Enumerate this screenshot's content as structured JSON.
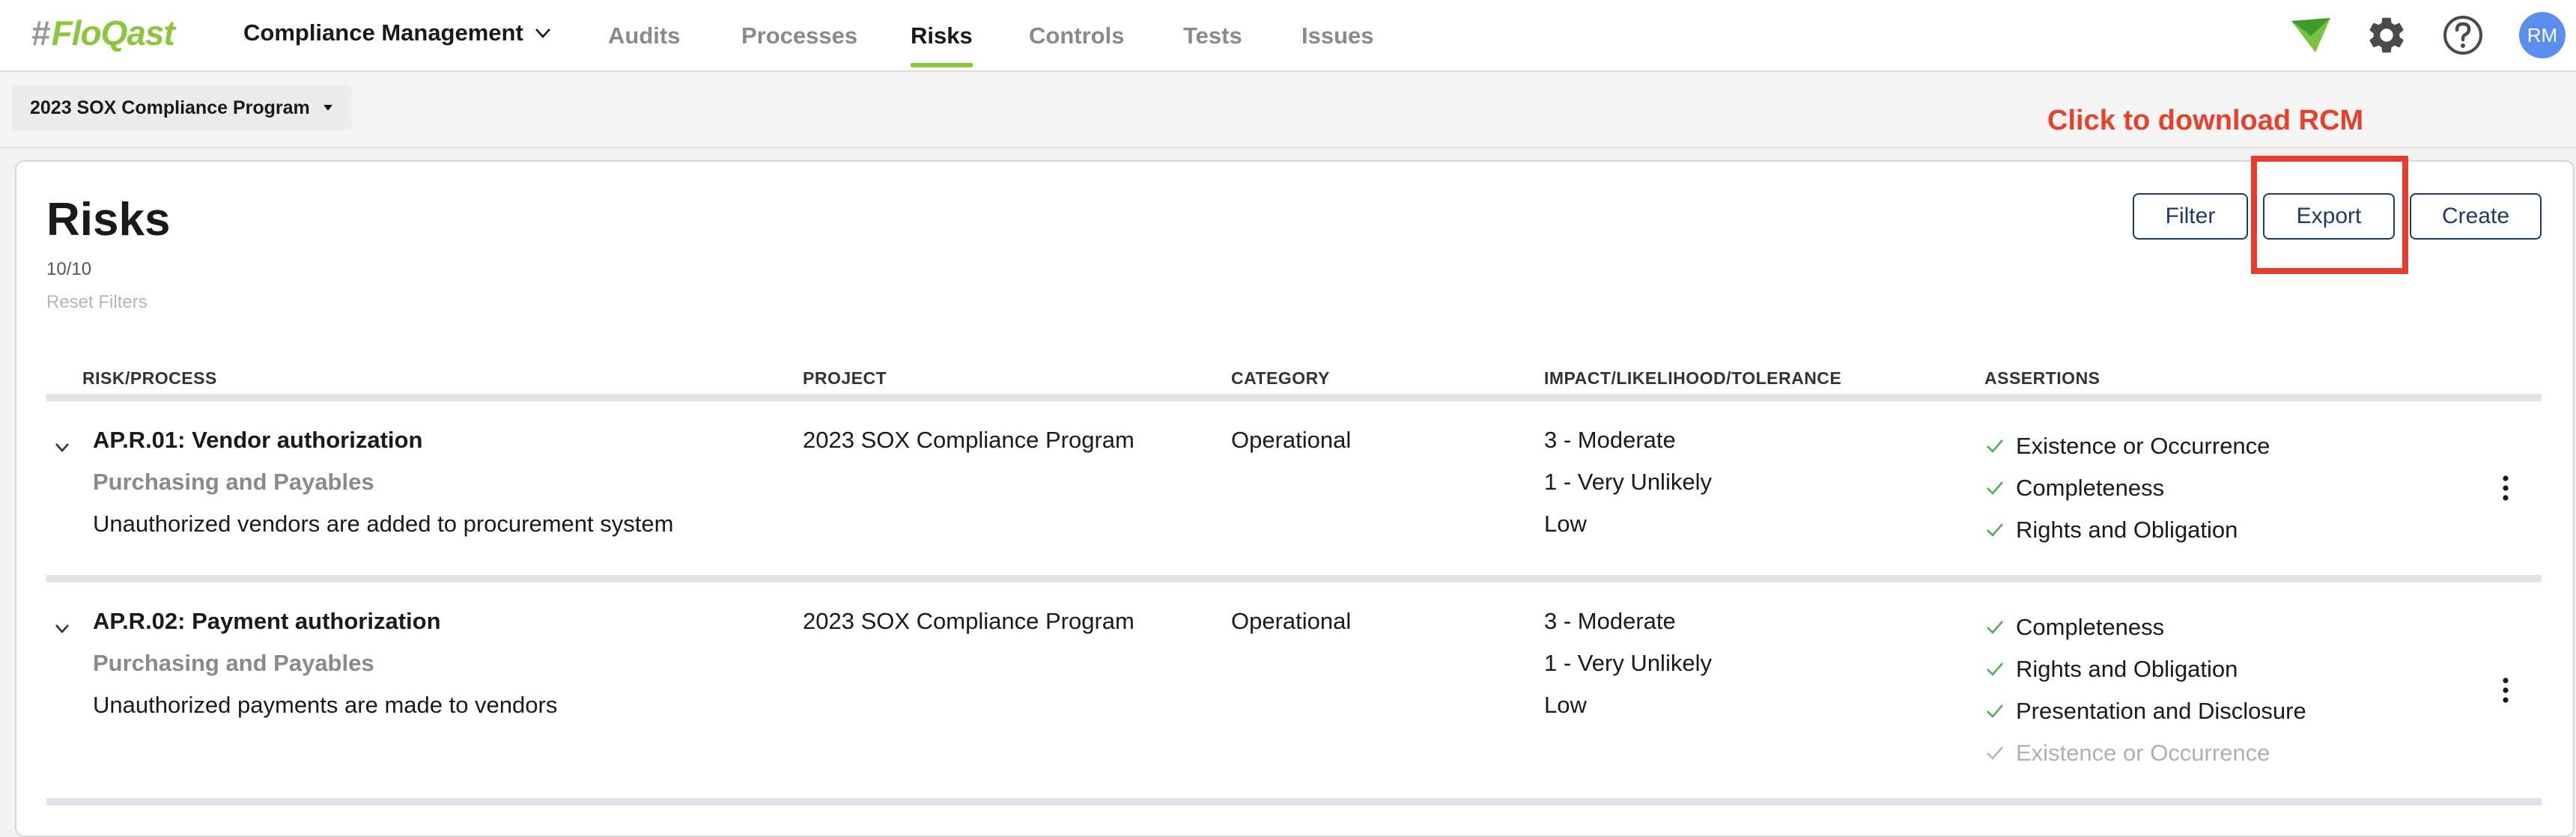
{
  "nav": {
    "logo_hash": "#",
    "logo_text": "FloQast",
    "module_label": "Compliance Management",
    "tabs": [
      {
        "label": "Audits"
      },
      {
        "label": "Processes"
      },
      {
        "label": "Risks"
      },
      {
        "label": "Controls"
      },
      {
        "label": "Tests"
      },
      {
        "label": "Issues"
      }
    ],
    "active_tab": "Risks",
    "avatar_initials": "RM",
    "icons": [
      "floqast-arrow-icon",
      "gear-icon",
      "help-icon"
    ],
    "accent_color": "#8cc63f"
  },
  "program_selector": {
    "label": "2023 SOX Compliance Program"
  },
  "annotation": {
    "text": "Click to download RCM",
    "color": "#e53d2f"
  },
  "page": {
    "title": "Risks",
    "count": "10/10",
    "reset_filters": "Reset Filters",
    "buttons": {
      "filter": "Filter",
      "export": "Export",
      "create": "Create"
    }
  },
  "table": {
    "headers": [
      "RISK/PROCESS",
      "PROJECT",
      "CATEGORY",
      "IMPACT/LIKELIHOOD/TOLERANCE",
      "ASSERTIONS"
    ],
    "rows": [
      {
        "risk": "AP.R.01: Vendor authorization",
        "process": "Purchasing and Payables",
        "description": "Unauthorized vendors are added to procurement system",
        "project": "2023 SOX Compliance Program",
        "category": "Operational",
        "impact": "3 - Moderate",
        "likelihood": "1 - Very Unlikely",
        "tolerance": "Low",
        "assertions": [
          {
            "label": "Existence or Occurrence",
            "active": true
          },
          {
            "label": "Completeness",
            "active": true
          },
          {
            "label": "Rights and Obligation",
            "active": true
          }
        ]
      },
      {
        "risk": "AP.R.02: Payment authorization",
        "process": "Purchasing and Payables",
        "description": "Unauthorized payments are made to vendors",
        "project": "2023 SOX Compliance Program",
        "category": "Operational",
        "impact": "3 - Moderate",
        "likelihood": "1 - Very Unlikely",
        "tolerance": "Low",
        "assertions": [
          {
            "label": "Completeness",
            "active": true
          },
          {
            "label": "Rights and Obligation",
            "active": true
          },
          {
            "label": "Presentation and Disclosure",
            "active": true
          },
          {
            "label": "Existence or Occurrence",
            "active": false
          }
        ]
      }
    ]
  }
}
